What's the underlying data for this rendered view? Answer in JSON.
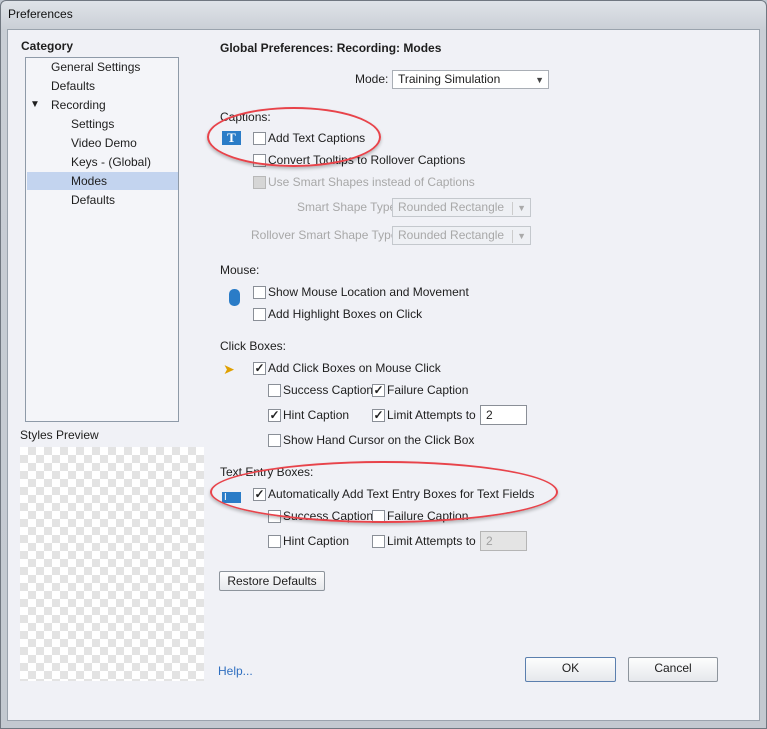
{
  "window": {
    "title": "Preferences"
  },
  "sidebar": {
    "heading": "Category",
    "items": [
      {
        "label": "General Settings",
        "level": 0
      },
      {
        "label": "Defaults",
        "level": 0
      },
      {
        "label": "Recording",
        "level": 0,
        "expanded": true
      },
      {
        "label": "Settings",
        "level": 1
      },
      {
        "label": "Video Demo",
        "level": 1
      },
      {
        "label": "Keys - (Global)",
        "level": 1
      },
      {
        "label": "Modes",
        "level": 1,
        "selected": true
      },
      {
        "label": "Defaults",
        "level": 1
      }
    ],
    "styles_preview_label": "Styles Preview"
  },
  "main": {
    "heading": "Global Preferences: Recording: Modes",
    "mode_label": "Mode:",
    "mode_value": "Training Simulation",
    "captions": {
      "label": "Captions:",
      "add_text_captions": "Add Text Captions",
      "convert_tooltips": "Convert Tooltips to Rollover Captions",
      "use_smart_shapes": "Use Smart Shapes instead of Captions",
      "smart_shape_type_label": "Smart Shape Type",
      "smart_shape_type_value": "Rounded Rectangle",
      "rollover_label": "Rollover Smart Shape Type",
      "rollover_value": "Rounded Rectangle"
    },
    "mouse": {
      "label": "Mouse:",
      "show_mouse": "Show Mouse Location and Movement",
      "highlight_boxes": "Add Highlight Boxes on Click"
    },
    "click_boxes": {
      "label": "Click Boxes:",
      "add": "Add Click Boxes on Mouse Click",
      "success": "Success Caption",
      "failure": "Failure Caption",
      "hint": "Hint Caption",
      "limit": "Limit Attempts to",
      "limit_value": "2",
      "hand_cursor": "Show Hand Cursor on the Click Box"
    },
    "text_entry": {
      "label": "Text Entry Boxes:",
      "auto_add": "Automatically Add Text Entry Boxes for Text Fields",
      "success": "Success Caption",
      "failure": "Failure Caption",
      "hint": "Hint Caption",
      "limit": "Limit Attempts to",
      "limit_value": "2"
    },
    "restore_defaults": "Restore Defaults"
  },
  "footer": {
    "help": "Help...",
    "ok": "OK",
    "cancel": "Cancel"
  },
  "colors": {
    "accent": "#2f6fc0",
    "highlight_ellipse": "#e8434a",
    "selection": "#c3d4ef"
  }
}
